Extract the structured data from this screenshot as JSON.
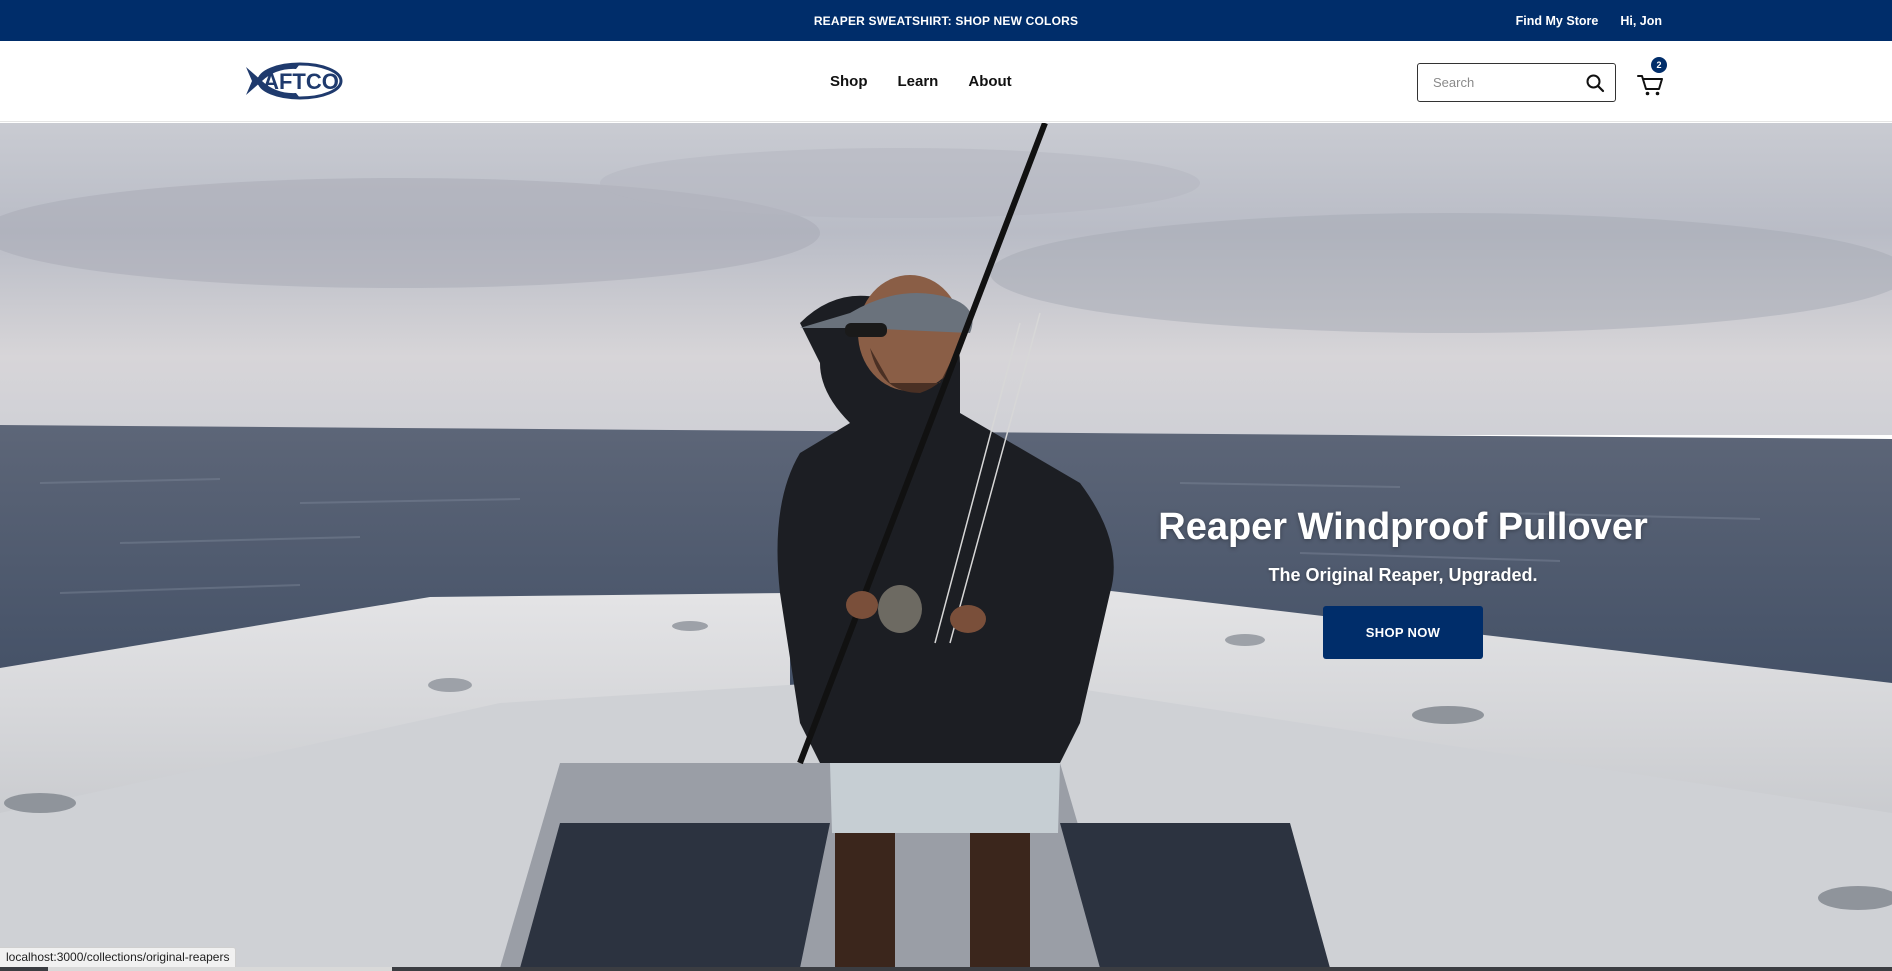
{
  "announcement": {
    "promo_text": "REAPER SWEATSHIRT: SHOP NEW COLORS",
    "find_store": "Find My Store",
    "greeting": "Hi, Jon"
  },
  "header": {
    "logo_text": "AFTCO",
    "nav": [
      "Shop",
      "Learn",
      "About"
    ],
    "search_placeholder": "Search",
    "cart_count": "2"
  },
  "hero": {
    "title": "Reaper Windproof Pullover",
    "subtitle": "The Original Reaper, Upgraded.",
    "cta": "SHOP NOW"
  },
  "status": {
    "url": "localhost:3000/collections/original-reapers"
  },
  "colors": {
    "brand_navy": "#002d6a"
  }
}
